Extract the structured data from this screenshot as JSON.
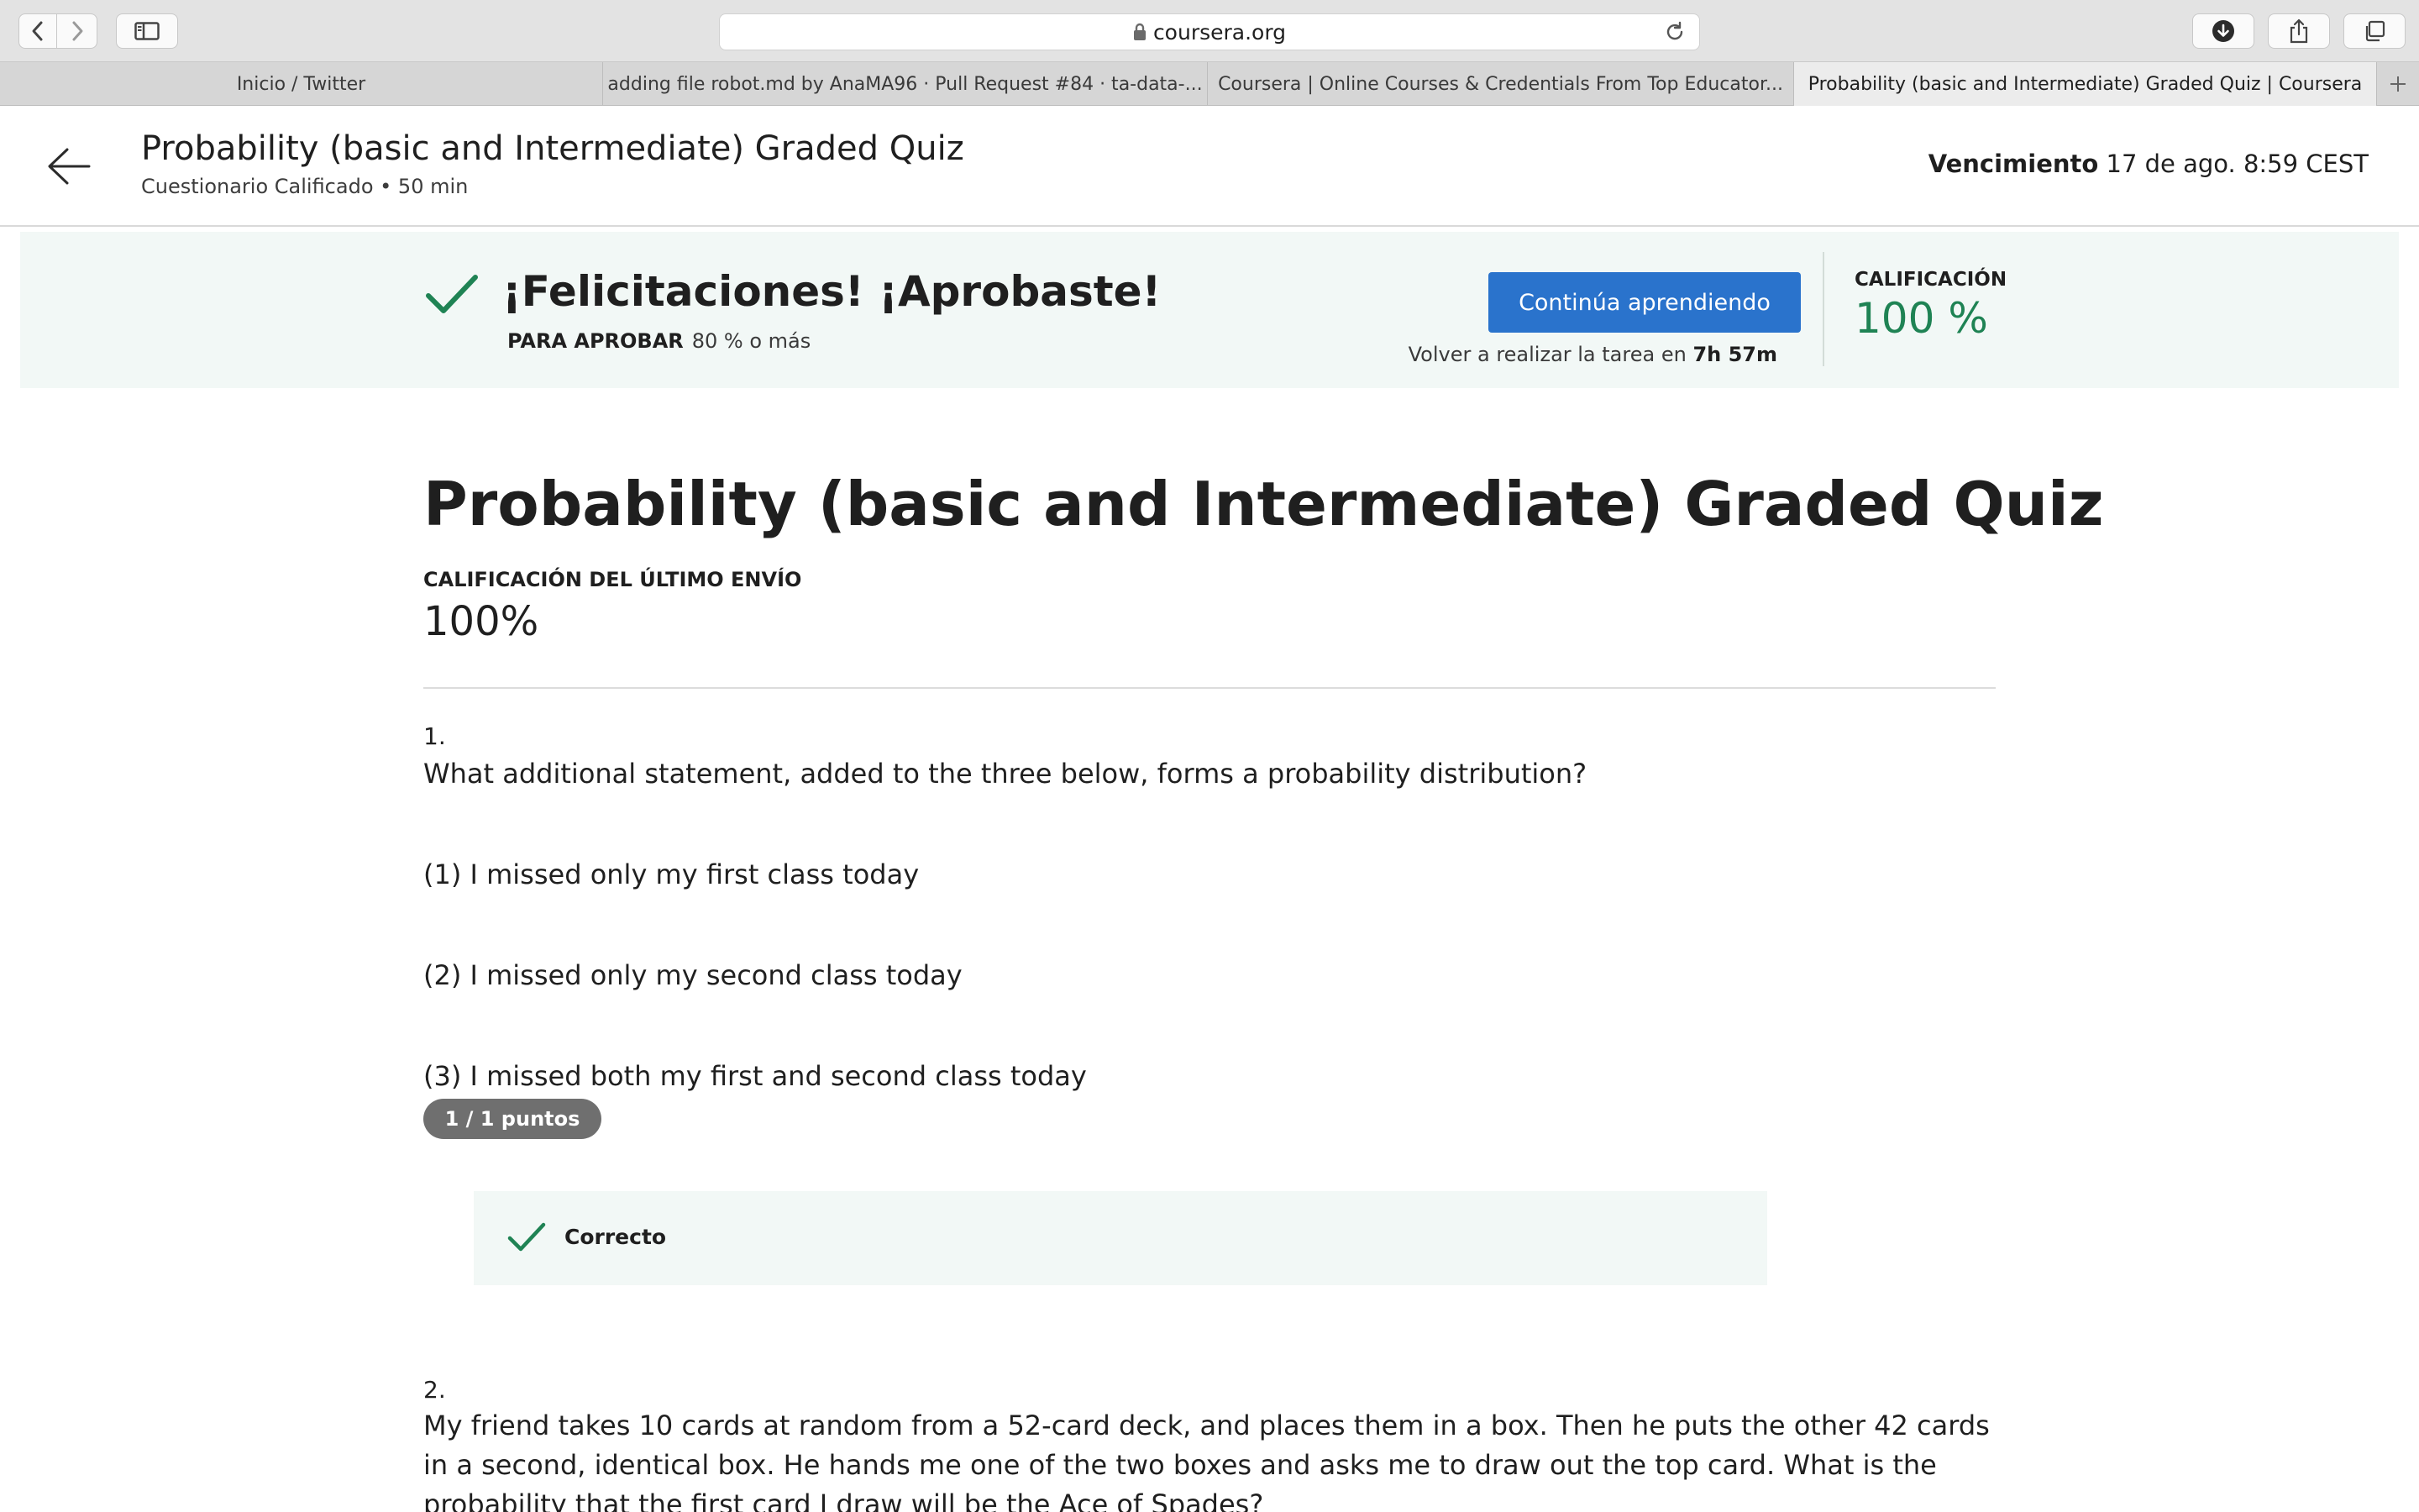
{
  "browser": {
    "url": "coursera.org",
    "tabs": [
      {
        "label": "Inicio / Twitter"
      },
      {
        "label": "adding file robot.md by AnaMA96 · Pull Request #84 · ta-data-..."
      },
      {
        "label": "Coursera | Online Courses & Credentials From Top Educator..."
      },
      {
        "label": "Probability (basic and Intermediate) Graded Quiz | Coursera"
      }
    ],
    "active_tab": 3
  },
  "header": {
    "title": "Probability (basic and Intermediate) Graded Quiz",
    "subtitle": "Cuestionario Calificado • 50 min",
    "due_label": "Vencimiento",
    "due_value": "17 de ago. 8:59 CEST"
  },
  "banner": {
    "congrats": "¡Felicitaciones! ¡Aprobaste!",
    "pass_label": "PARA APROBAR",
    "pass_value": "80 % o más",
    "cta_label": "Continúa aprendiendo",
    "retry_prefix": "Volver a realizar la tarea en",
    "retry_time": "7h 57m",
    "grade_label": "CALIFICACIÓN",
    "grade_value": "100 %",
    "colors": {
      "background": "#f2f8f6",
      "accent": "#2a73cc",
      "success": "#1f8354"
    }
  },
  "main": {
    "title": "Probability (basic and Intermediate) Graded Quiz",
    "last_submission_label": "CALIFICACIÓN DEL ÚLTIMO ENVÍO",
    "last_submission_value": "100%",
    "questions": [
      {
        "number": "1.",
        "text": "What additional statement, added to the three below, forms a probability distribution?",
        "statements": [
          "(1) I missed only my first class today",
          "(2) I missed only my second class today",
          "(3) I missed both my first and second class today"
        ],
        "points": "1 / 1 puntos",
        "feedback": "Correcto"
      },
      {
        "number": "2.",
        "text": "My friend takes 10 cards at random from a 52-card deck, and places them in a box. Then he puts the other 42 cards in a second, identical box. He hands me one of the two boxes and asks me to draw out the top card. What is the probability that the first card I draw will be the Ace of Spades?"
      }
    ]
  },
  "icons": {
    "back": "chevron-left-icon",
    "forward": "chevron-right-icon",
    "sidebar": "sidebar-icon",
    "lock": "lock-icon",
    "reload": "reload-icon",
    "download": "download-icon",
    "share": "share-icon",
    "tabs": "tabs-icon",
    "new_tab": "plus-icon",
    "page_back": "arrow-left-icon",
    "check": "check-icon"
  }
}
